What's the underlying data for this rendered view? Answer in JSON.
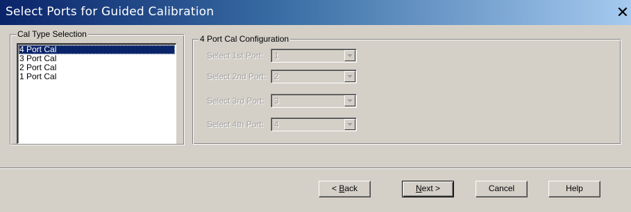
{
  "window": {
    "title": "Select Ports for Guided Calibration",
    "close_glyph": "✕"
  },
  "cal_type_group": {
    "label": "Cal Type Selection",
    "items": [
      {
        "label": "4 Port Cal",
        "selected": true
      },
      {
        "label": "3 Port Cal",
        "selected": false
      },
      {
        "label": "2 Port Cal",
        "selected": false
      },
      {
        "label": "1 Port Cal",
        "selected": false
      }
    ]
  },
  "config_group": {
    "label": "4 Port Cal Configuration",
    "rows": [
      {
        "label": "Select 1st Port:",
        "value": "1"
      },
      {
        "label": "Select 2nd Port:",
        "value": "2"
      },
      {
        "label": "Select 3rd Port:",
        "value": "3"
      },
      {
        "label": "Select 4th Port:",
        "value": "4"
      }
    ]
  },
  "buttons": {
    "back_prefix": "< ",
    "back_mnemonic": "B",
    "back_rest": "ack",
    "next_mnemonic": "N",
    "next_rest": "ext >",
    "cancel": "Cancel",
    "help": "Help"
  },
  "colors": {
    "dialog_bg": "#d4d0c8",
    "title_start": "#0a246a",
    "title_end": "#a6caf0",
    "selection": "#0a246a",
    "disabled_text": "#a0a0a0"
  },
  "icons": {
    "close": "close-icon",
    "dropdown": "chevron-down-icon"
  }
}
